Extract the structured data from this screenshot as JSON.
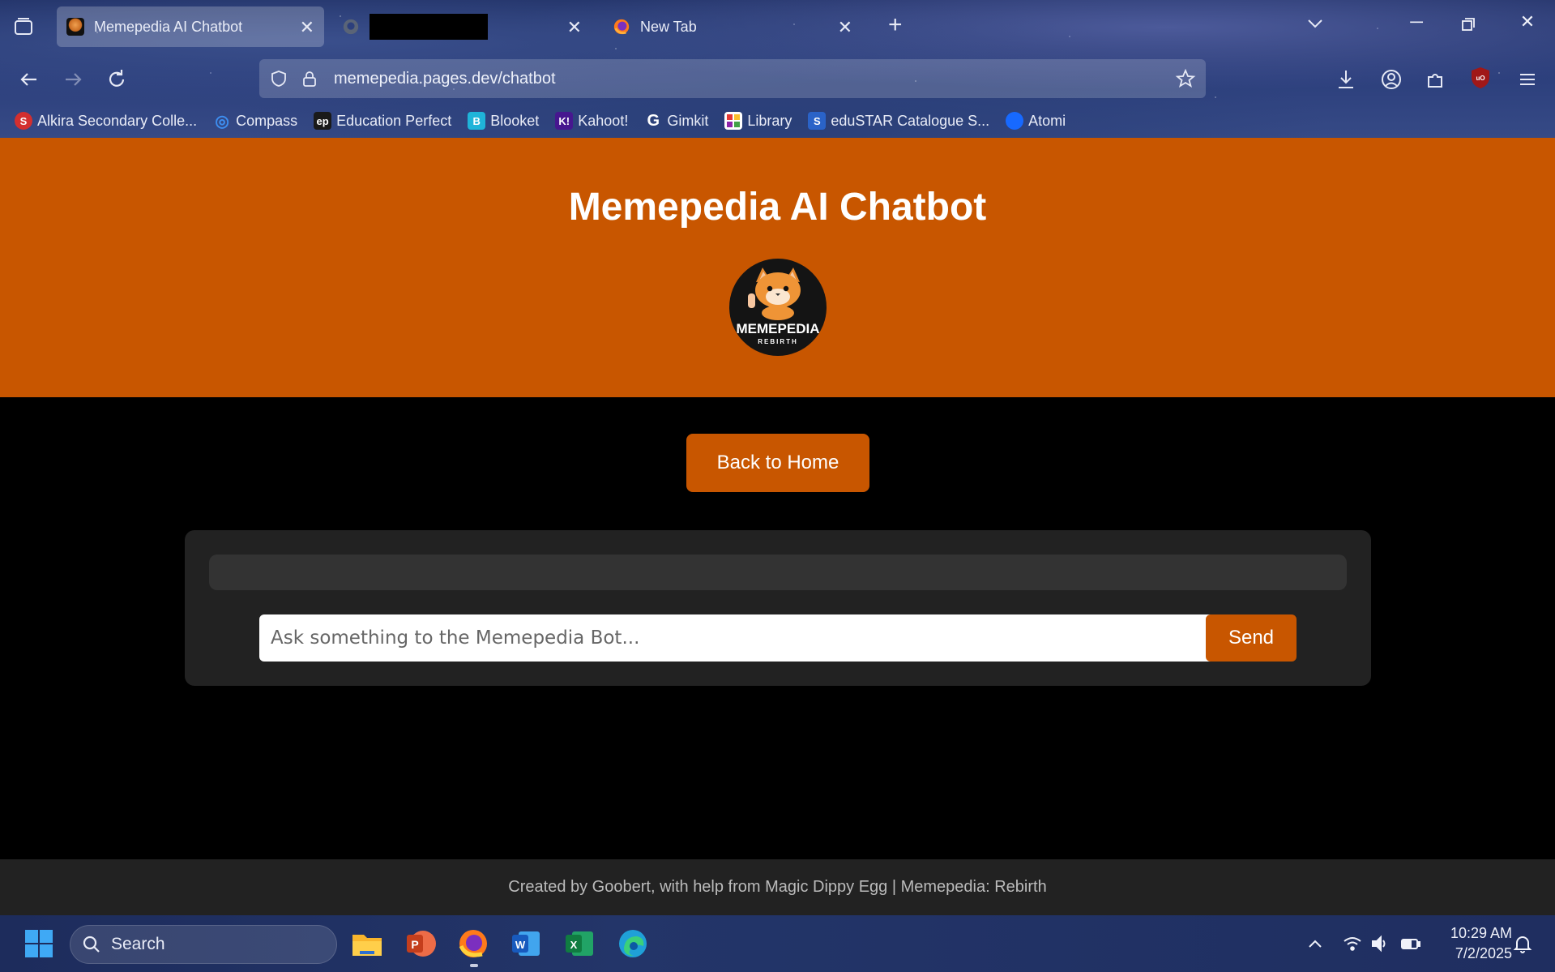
{
  "browser": {
    "tabs": [
      {
        "title": "Memepedia AI Chatbot",
        "active": true,
        "favicon": "memepedia-logo-icon"
      },
      {
        "title": "",
        "active": false,
        "favicon": "github-icon",
        "redacted": true
      },
      {
        "title": "New Tab",
        "active": false,
        "favicon": "firefox-icon"
      }
    ],
    "url": "memepedia.pages.dev/chatbot",
    "bookmarks": [
      {
        "label": "Alkira Secondary Colle...",
        "icon": "school-icon",
        "color": "#d32f2f",
        "glyph": "S"
      },
      {
        "label": "Compass",
        "icon": "compass-icon",
        "color": "#1e88e5",
        "glyph": "◎"
      },
      {
        "label": "Education Perfect",
        "icon": "education-perfect-icon",
        "color": "#1a1a1a",
        "glyph": "ep"
      },
      {
        "label": "Blooket",
        "icon": "blooket-icon",
        "color": "#1fb4d9",
        "glyph": "B"
      },
      {
        "label": "Kahoot!",
        "icon": "kahoot-icon",
        "color": "#46178f",
        "glyph": "K!"
      },
      {
        "label": "Gimkit",
        "icon": "gimkit-icon",
        "color": "#222",
        "glyph": "G"
      },
      {
        "label": "Library",
        "icon": "library-icon",
        "color": "#ffffff",
        "glyph": "▦"
      },
      {
        "label": "eduSTAR Catalogue S...",
        "icon": "edustar-icon",
        "color": "#2a63c8",
        "glyph": "S"
      },
      {
        "label": "Atomi",
        "icon": "atomi-icon",
        "color": "#1769ff",
        "glyph": ""
      }
    ]
  },
  "page": {
    "title": "Memepedia AI Chatbot",
    "logo_text": "MEMEPEDIA",
    "logo_subtext": "REBIRTH",
    "back_button": "Back to Home",
    "chat_placeholder": "Ask something to the Memepedia Bot...",
    "send_button": "Send",
    "footer": "Created by Goobert, with help from Magic Dippy Egg | Memepedia: Rebirth",
    "accent_color": "#c85600"
  },
  "taskbar": {
    "search_label": "Search",
    "time": "10:29 AM",
    "date": "7/2/2025",
    "pinned_apps": [
      "file-explorer-icon",
      "powerpoint-icon",
      "firefox-icon",
      "word-icon",
      "excel-icon",
      "edge-icon"
    ]
  }
}
